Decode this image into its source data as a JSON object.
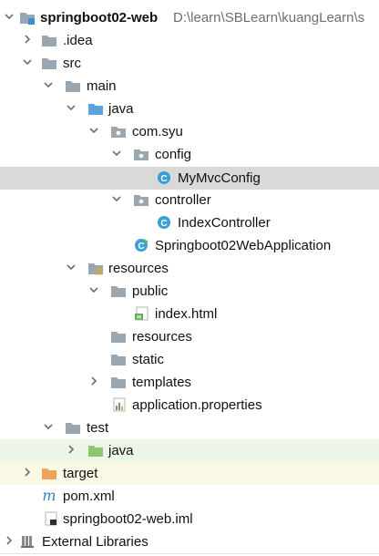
{
  "tree": {
    "project": {
      "name": "springboot02-web",
      "path": "D:\\learn\\SBLearn\\kuangLearn\\s"
    },
    "idea": "idea",
    "src": "src",
    "main": "main",
    "java": "java",
    "package": "com.syu",
    "config": "config",
    "mymvcconfig": "MyMvcConfig",
    "controller": "controller",
    "indexcontroller": "IndexController",
    "application": "Springboot02WebApplication",
    "resources": "resources",
    "public": "public",
    "indexhtml": "index.html",
    "resources_sub": "resources",
    "static": "static",
    "templates": "templates",
    "properties": "application.properties",
    "test": "test",
    "test_java": "java",
    "target": "target",
    "pom": "pom.xml",
    "iml": "springboot02-web.iml",
    "external": "External Libraries"
  },
  "colors": {
    "selected_row": "#d9d9d9",
    "test_row": "#ecf6e6",
    "target_row": "#fbf8e6",
    "folder": "#9aa7b1",
    "source_folder": "#5aa4dc",
    "resource_folder": "#9aa7b1",
    "test_folder": "#8dc66d",
    "target_folder": "#f0a35c",
    "class_icon": "#3a9fd6"
  }
}
